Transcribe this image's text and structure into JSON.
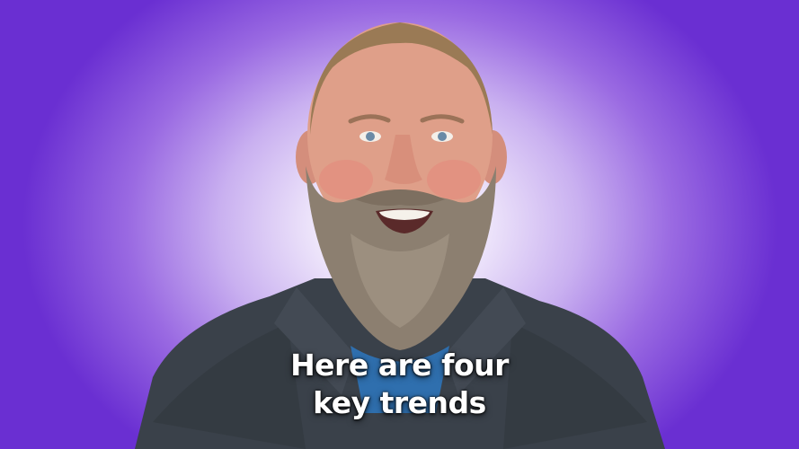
{
  "captions": {
    "line1": "Here are four",
    "line2": "key trends"
  },
  "colors": {
    "background_center": "#ffffff",
    "background_edge": "#6a2fd2",
    "shirt": "#3a414a",
    "undershirt": "#2f6fae",
    "beard": "#8c7f70",
    "caption_text": "#ffffff"
  },
  "scene": {
    "subject": "bearded-man-speaking",
    "background": "purple-radial-gradient"
  }
}
